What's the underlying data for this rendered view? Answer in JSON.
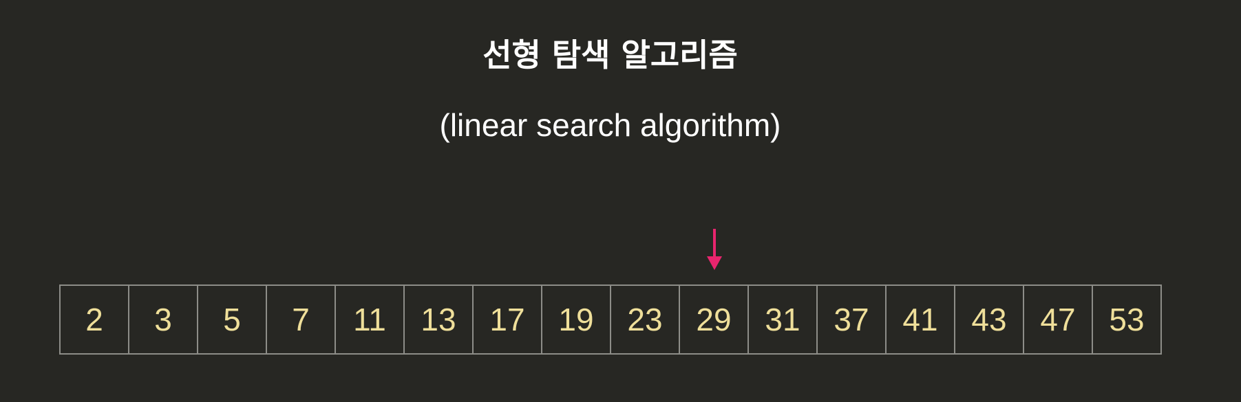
{
  "slide": {
    "title": "선형 탐색 알고리즘",
    "subtitle": "(linear search algorithm)"
  },
  "array": {
    "cells": [
      "2",
      "3",
      "5",
      "7",
      "11",
      "13",
      "17",
      "19",
      "23",
      "29",
      "31",
      "37",
      "41",
      "43",
      "47",
      "53"
    ],
    "pointer_index": 9
  },
  "colors": {
    "background": "#272723",
    "title": "#ffffff",
    "cell_text": "#efdf9a",
    "cell_border": "#8d8d88",
    "pointer": "#e8256e"
  },
  "icons": {
    "pointer": "down-arrow-icon"
  }
}
